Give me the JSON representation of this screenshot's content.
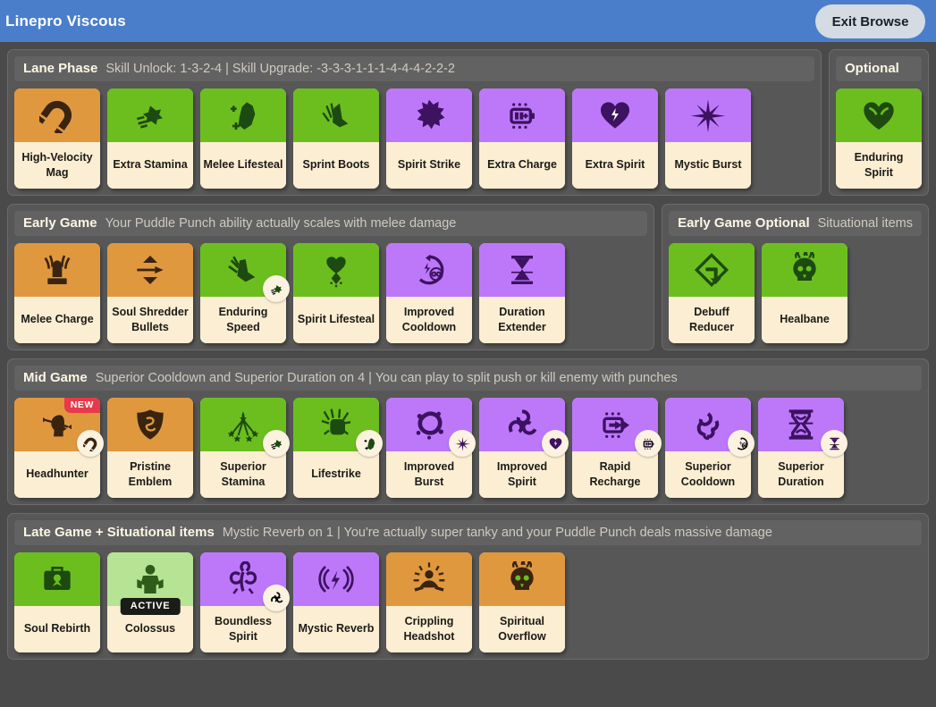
{
  "titlebar": {
    "title": "Linepro Viscous",
    "exit_label": "Exit Browse"
  },
  "sections": [
    {
      "id": "lane-phase",
      "title": "Lane Phase",
      "note": "Skill Unlock: 1-3-2-4 | Skill Upgrade: -3-3-3-1-1-1-4-4-4-2-2-2",
      "side": {
        "id": "optional",
        "title": "Optional",
        "note": "",
        "cards": [
          {
            "name": "Enduring Spirit",
            "color": "green",
            "icon": "heart-wings-icon",
            "badge": null,
            "flag": null
          }
        ]
      },
      "cards": [
        {
          "name": "High-Velocity Mag",
          "color": "orange",
          "icon": "magnet-icon",
          "badge": null,
          "flag": null
        },
        {
          "name": "Extra Stamina",
          "color": "green",
          "icon": "boot-dash-icon",
          "badge": null,
          "flag": null
        },
        {
          "name": "Melee Lifesteal",
          "color": "green",
          "icon": "gauntlet-plus-icon",
          "badge": null,
          "flag": null
        },
        {
          "name": "Sprint Boots",
          "color": "green",
          "icon": "sprint-boot-icon",
          "badge": null,
          "flag": null
        },
        {
          "name": "Spirit Strike",
          "color": "purple",
          "icon": "fist-burst-icon",
          "badge": null,
          "flag": null
        },
        {
          "name": "Extra Charge",
          "color": "purple",
          "icon": "battery-plus-icon",
          "badge": null,
          "flag": null
        },
        {
          "name": "Extra Spirit",
          "color": "purple",
          "icon": "heart-bolt-icon",
          "badge": null,
          "flag": null
        },
        {
          "name": "Mystic Burst",
          "color": "purple",
          "icon": "starburst-icon",
          "badge": null,
          "flag": null
        }
      ]
    },
    {
      "id": "early-game",
      "title": "Early Game",
      "note": "Your Puddle Punch ability actually scales with melee damage",
      "side": {
        "id": "early-game-optional",
        "title": "Early Game Optional",
        "note": "Situational items",
        "cards": [
          {
            "name": "Debuff Reducer",
            "color": "green",
            "icon": "shield-down-arrow-icon",
            "badge": null,
            "flag": null
          },
          {
            "name": "Healbane",
            "color": "green",
            "icon": "flaming-skull-icon",
            "badge": null,
            "flag": null
          }
        ]
      },
      "cards": [
        {
          "name": "Melee Charge",
          "color": "orange",
          "icon": "charged-fist-icon",
          "badge": null,
          "flag": null
        },
        {
          "name": "Soul Shredder Bullets",
          "color": "orange",
          "icon": "bullet-arrows-icon",
          "badge": null,
          "flag": null
        },
        {
          "name": "Enduring Speed",
          "color": "green",
          "icon": "winged-boot-icon",
          "badge": "boot-dash-icon",
          "flag": null
        },
        {
          "name": "Spirit Lifesteal",
          "color": "green",
          "icon": "heart-drip-icon",
          "badge": null,
          "flag": null
        },
        {
          "name": "Improved Cooldown",
          "color": "purple",
          "icon": "cooldown-infinity-icon",
          "badge": null,
          "flag": null
        },
        {
          "name": "Duration Extender",
          "color": "purple",
          "icon": "hourglass-icon",
          "badge": null,
          "flag": null
        }
      ]
    },
    {
      "id": "mid-game",
      "title": "Mid Game",
      "note": "Superior Cooldown and Superior Duration on 4 | You can play to split push or kill enemy with punches",
      "side": null,
      "cards": [
        {
          "name": "Headhunter",
          "color": "orange",
          "icon": "head-arrow-icon",
          "badge": "magnet-icon",
          "flag": "NEW"
        },
        {
          "name": "Pristine Emblem",
          "color": "orange",
          "icon": "shield-swirl-icon",
          "badge": null,
          "flag": null
        },
        {
          "name": "Superior Stamina",
          "color": "green",
          "icon": "stamina-burst-icon",
          "badge": "boot-dash-icon",
          "flag": null
        },
        {
          "name": "Lifestrike",
          "color": "green",
          "icon": "impact-fist-icon",
          "badge": "gauntlet-plus-icon",
          "flag": null
        },
        {
          "name": "Improved Burst",
          "color": "purple",
          "icon": "splash-burst-icon",
          "badge": "starburst-icon",
          "flag": null
        },
        {
          "name": "Improved Spirit",
          "color": "purple",
          "icon": "triple-swirl-icon",
          "badge": "heart-bolt-icon",
          "flag": null
        },
        {
          "name": "Rapid Recharge",
          "color": "purple",
          "icon": "battery-arrow-icon",
          "badge": "battery-plus-icon",
          "flag": null
        },
        {
          "name": "Superior Cooldown",
          "color": "purple",
          "icon": "tentacle-swirl-icon",
          "badge": "cooldown-infinity-icon",
          "flag": null
        },
        {
          "name": "Superior Duration",
          "color": "purple",
          "icon": "ornate-hourglass-icon",
          "badge": "hourglass-icon",
          "flag": null
        }
      ]
    },
    {
      "id": "late-game",
      "title": "Late Game + Situational items",
      "note": "Mystic Reverb on 1 | You're actually super tanky and your Puddle Punch deals massive damage",
      "side": null,
      "cards": [
        {
          "name": "Soul Rebirth",
          "color": "green",
          "icon": "briefcase-soul-icon",
          "badge": null,
          "flag": null
        },
        {
          "name": "Colossus",
          "color": "lgreen",
          "icon": "colossus-figure-icon",
          "badge": null,
          "flag": "ACTIVE"
        },
        {
          "name": "Boundless Spirit",
          "color": "purple",
          "icon": "spirit-bloom-icon",
          "badge": "triple-swirl-icon",
          "flag": null
        },
        {
          "name": "Mystic Reverb",
          "color": "purple",
          "icon": "reverb-bolt-icon",
          "badge": null,
          "flag": null
        },
        {
          "name": "Crippling Headshot",
          "color": "orange",
          "icon": "meditate-sun-icon",
          "badge": null,
          "flag": null
        },
        {
          "name": "Spiritual Overflow",
          "color": "orange",
          "icon": "flaming-skull-icon",
          "badge": null,
          "flag": null
        }
      ]
    }
  ],
  "colors": {
    "accent": "#4a7ecb",
    "green": "#6cbe1f",
    "light_green": "#b7e394",
    "purple": "#bd78fa",
    "orange": "#e0983f",
    "card_name_bg": "#fbeed2",
    "panel_bg": "#575757",
    "page_bg": "#4a4a4a",
    "new_flag": "#e8394a",
    "active_flag": "#1b1b18"
  }
}
